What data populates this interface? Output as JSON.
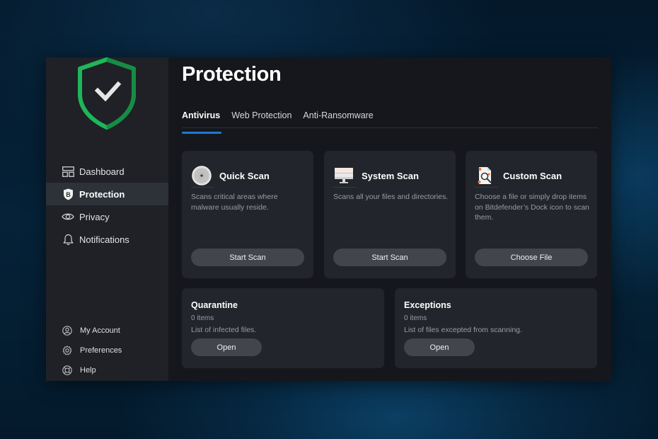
{
  "app": {
    "brand_color": "#1fb65a",
    "accent_color": "#1f78d1"
  },
  "sidebar": {
    "logo_icon": "shield-check-icon",
    "items": [
      {
        "label": "Dashboard",
        "icon": "dashboard-icon",
        "active": false
      },
      {
        "label": "Protection",
        "icon": "bitdefender-shield-icon",
        "active": true
      },
      {
        "label": "Privacy",
        "icon": "eye-icon",
        "active": false
      },
      {
        "label": "Notifications",
        "icon": "bell-icon",
        "active": false
      }
    ],
    "bottom_items": [
      {
        "label": "My Account",
        "icon": "user-circle-icon"
      },
      {
        "label": "Preferences",
        "icon": "gear-icon"
      },
      {
        "label": "Help",
        "icon": "lifebuoy-icon"
      }
    ]
  },
  "main": {
    "title": "Protection",
    "tabs": [
      {
        "label": "Antivirus",
        "active": true
      },
      {
        "label": "Web Protection",
        "active": false
      },
      {
        "label": "Anti-Ransomware",
        "active": false
      }
    ],
    "scan_cards": [
      {
        "title": "Quick Scan",
        "icon": "disc-icon",
        "description": "Scans critical areas where malware usually reside.",
        "button": "Start Scan"
      },
      {
        "title": "System Scan",
        "icon": "monitor-icon",
        "description": "Scans all your files and directories.",
        "button": "Start Scan"
      },
      {
        "title": "Custom Scan",
        "icon": "file-search-icon",
        "description": "Choose a file or simply drop items on Bitdefender’s Dock icon to scan them.",
        "button": "Choose File"
      }
    ],
    "list_cards": [
      {
        "title": "Quarantine",
        "count": "0 items",
        "description": "List of infected files.",
        "button": "Open"
      },
      {
        "title": "Exceptions",
        "count": "0 items",
        "description": "List of files excepted from scanning.",
        "button": "Open"
      }
    ]
  }
}
